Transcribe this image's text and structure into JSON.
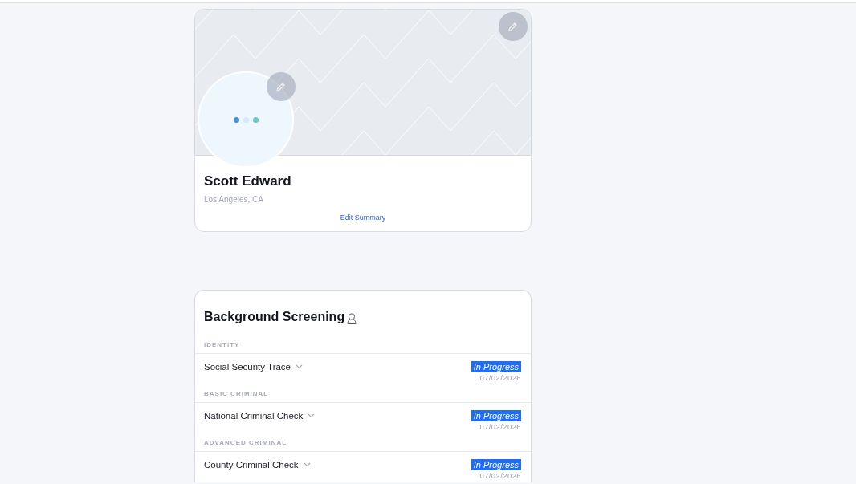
{
  "profile": {
    "name": "Scott Edward",
    "location": "Los Angeles, CA",
    "edit_link": "Edit Summary"
  },
  "screening": {
    "title": "Background Screening",
    "sections": [
      {
        "label": "IDENTITY",
        "checks": [
          {
            "name": "Social Security Trace",
            "expanded": false,
            "status": "In Progress",
            "date": "07/02/2026"
          }
        ]
      },
      {
        "label": "BASIC CRIMINAL",
        "checks": [
          {
            "name": "National Criminal Check",
            "expanded": false,
            "status": "In Progress",
            "date": "07/02/2026"
          }
        ]
      },
      {
        "label": "ADVANCED CRIMINAL",
        "checks": [
          {
            "name": "County Criminal Check",
            "expanded": false,
            "status": "In Progress",
            "date": "07/02/2026"
          }
        ]
      }
    ]
  }
}
